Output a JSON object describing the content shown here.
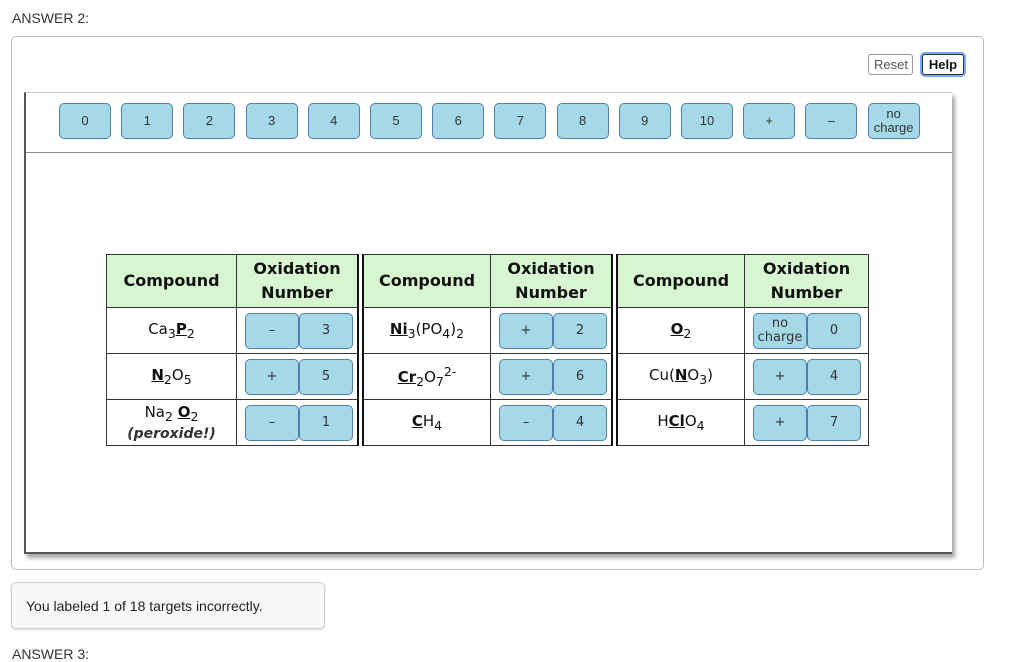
{
  "answer_label": "ANSWER 2:",
  "toolbar": {
    "reset_label": "Reset",
    "help_label": "Help"
  },
  "bank": [
    "0",
    "1",
    "2",
    "3",
    "4",
    "5",
    "6",
    "7",
    "8",
    "9",
    "10",
    "+",
    "–",
    "no charge"
  ],
  "table": {
    "headers": {
      "compound": "Compound",
      "oxidation": "Oxidation Number"
    },
    "groups": [
      {
        "rows": [
          {
            "compound_html": "Ca<sub>3</sub><u><b>P</b></u><sub>2</sub>",
            "sign": "–",
            "value": "3"
          },
          {
            "compound_html": "<u><b>N</b></u><sub>2</sub>O<sub>5</sub>",
            "sign": "+",
            "value": "5"
          },
          {
            "compound_html": "Na<sub>2</sub> <u><b>O</b></u><sub>2</sub><br><span class='sub2'>(peroxide!)</span>",
            "sign": "–",
            "value": "1"
          }
        ]
      },
      {
        "rows": [
          {
            "compound_html": "<u><b>Ni</b></u><sub>3</sub>(PO<sub>4</sub>)<sub>2</sub>",
            "sign": "+",
            "value": "2"
          },
          {
            "compound_html": "<u><b>Cr</b></u><sub>2</sub>O<sub>7</sub><sup>2-</sup>",
            "sign": "+",
            "value": "6"
          },
          {
            "compound_html": "<u><b>C</b></u>H<sub>4</sub>",
            "sign": "–",
            "value": "4"
          }
        ]
      },
      {
        "rows": [
          {
            "compound_html": "<u><b>O</b></u><sub>2</sub>",
            "sign": "no charge",
            "value": "0"
          },
          {
            "compound_html": "Cu(<u><b>N</b></u>O<sub>3</sub>)",
            "sign": "+",
            "value": "4"
          },
          {
            "compound_html": "H<u><b>Cl</b></u>O<sub>4</sub>",
            "sign": "+",
            "value": "7"
          }
        ]
      }
    ]
  },
  "feedback": "You labeled 1 of 18 targets incorrectly.",
  "next_label": "ANSWER 3:"
}
